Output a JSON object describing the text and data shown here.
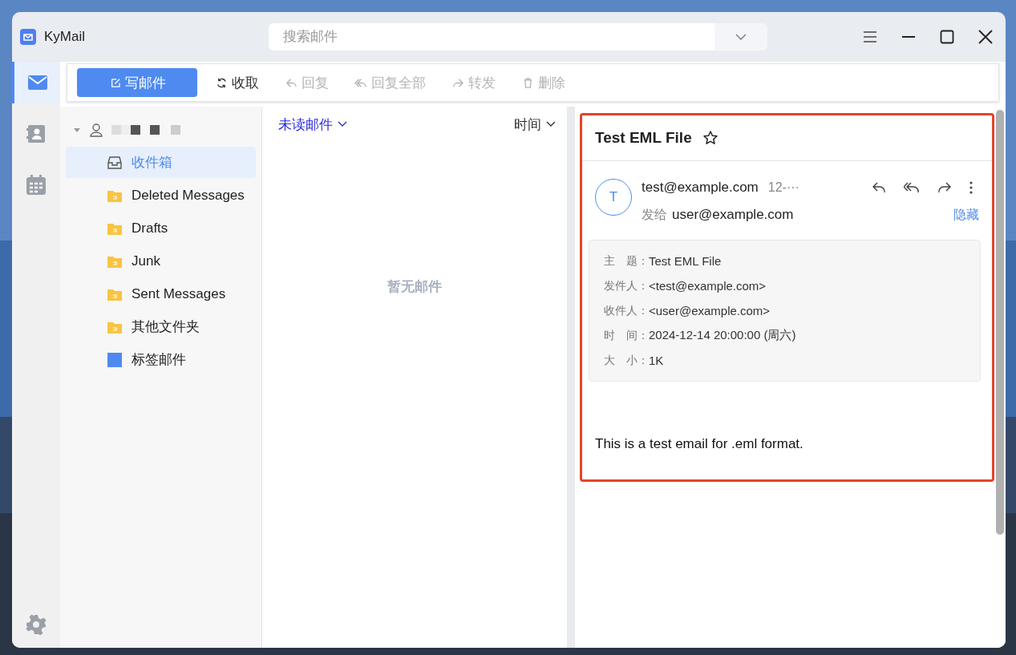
{
  "window": {
    "title": "KyMail"
  },
  "search": {
    "placeholder": "搜索邮件"
  },
  "nav_rail": [
    {
      "kind": "mail",
      "selected": true
    },
    {
      "kind": "contacts",
      "selected": false
    },
    {
      "kind": "calendar",
      "selected": false
    }
  ],
  "toolbar": [
    {
      "kind": "compose",
      "label": "写邮件",
      "disabled": false
    },
    {
      "kind": "refresh",
      "label": "收取",
      "disabled": false
    },
    {
      "kind": "reply",
      "label": "回复",
      "disabled": true
    },
    {
      "kind": "reply_all",
      "label": "回复全部",
      "disabled": true
    },
    {
      "kind": "forward",
      "label": "转发",
      "disabled": true
    },
    {
      "kind": "delete",
      "label": "删除",
      "disabled": true
    }
  ],
  "account": {
    "expanded": true
  },
  "folders": [
    {
      "kind": "inbox",
      "label": "收件箱",
      "selected": true
    },
    {
      "kind": "folder",
      "label": "Deleted Messages",
      "selected": false
    },
    {
      "kind": "folder",
      "label": "Drafts",
      "selected": false
    },
    {
      "kind": "folder",
      "label": "Junk",
      "selected": false
    },
    {
      "kind": "folder",
      "label": "Sent Messages",
      "selected": false
    },
    {
      "kind": "folder",
      "label": "其他文件夹",
      "selected": false
    },
    {
      "kind": "tag",
      "label": "标签邮件",
      "selected": false
    }
  ],
  "message_list": {
    "filter": "未读邮件",
    "sort": "时间",
    "empty_text": "暂无邮件"
  },
  "message": {
    "subject": "Test EML File",
    "starred": false,
    "avatar": "T",
    "from": "test@example.com",
    "date": "12-···",
    "to_label": "发给",
    "to": "user@example.com",
    "hide_link": "隐藏",
    "details": [
      {
        "label": "主　题：",
        "value": "Test EML File"
      },
      {
        "label": "发件人：",
        "value": "<test@example.com>"
      },
      {
        "label": "收件人：",
        "value": "<user@example.com>"
      },
      {
        "label": "时　间：",
        "value": "2024-12-14 20:00:00 (周六)"
      },
      {
        "label": "大　小：",
        "value": "1K"
      }
    ],
    "body": "This is a test email for .eml format."
  },
  "highlight": {
    "shown": true
  }
}
